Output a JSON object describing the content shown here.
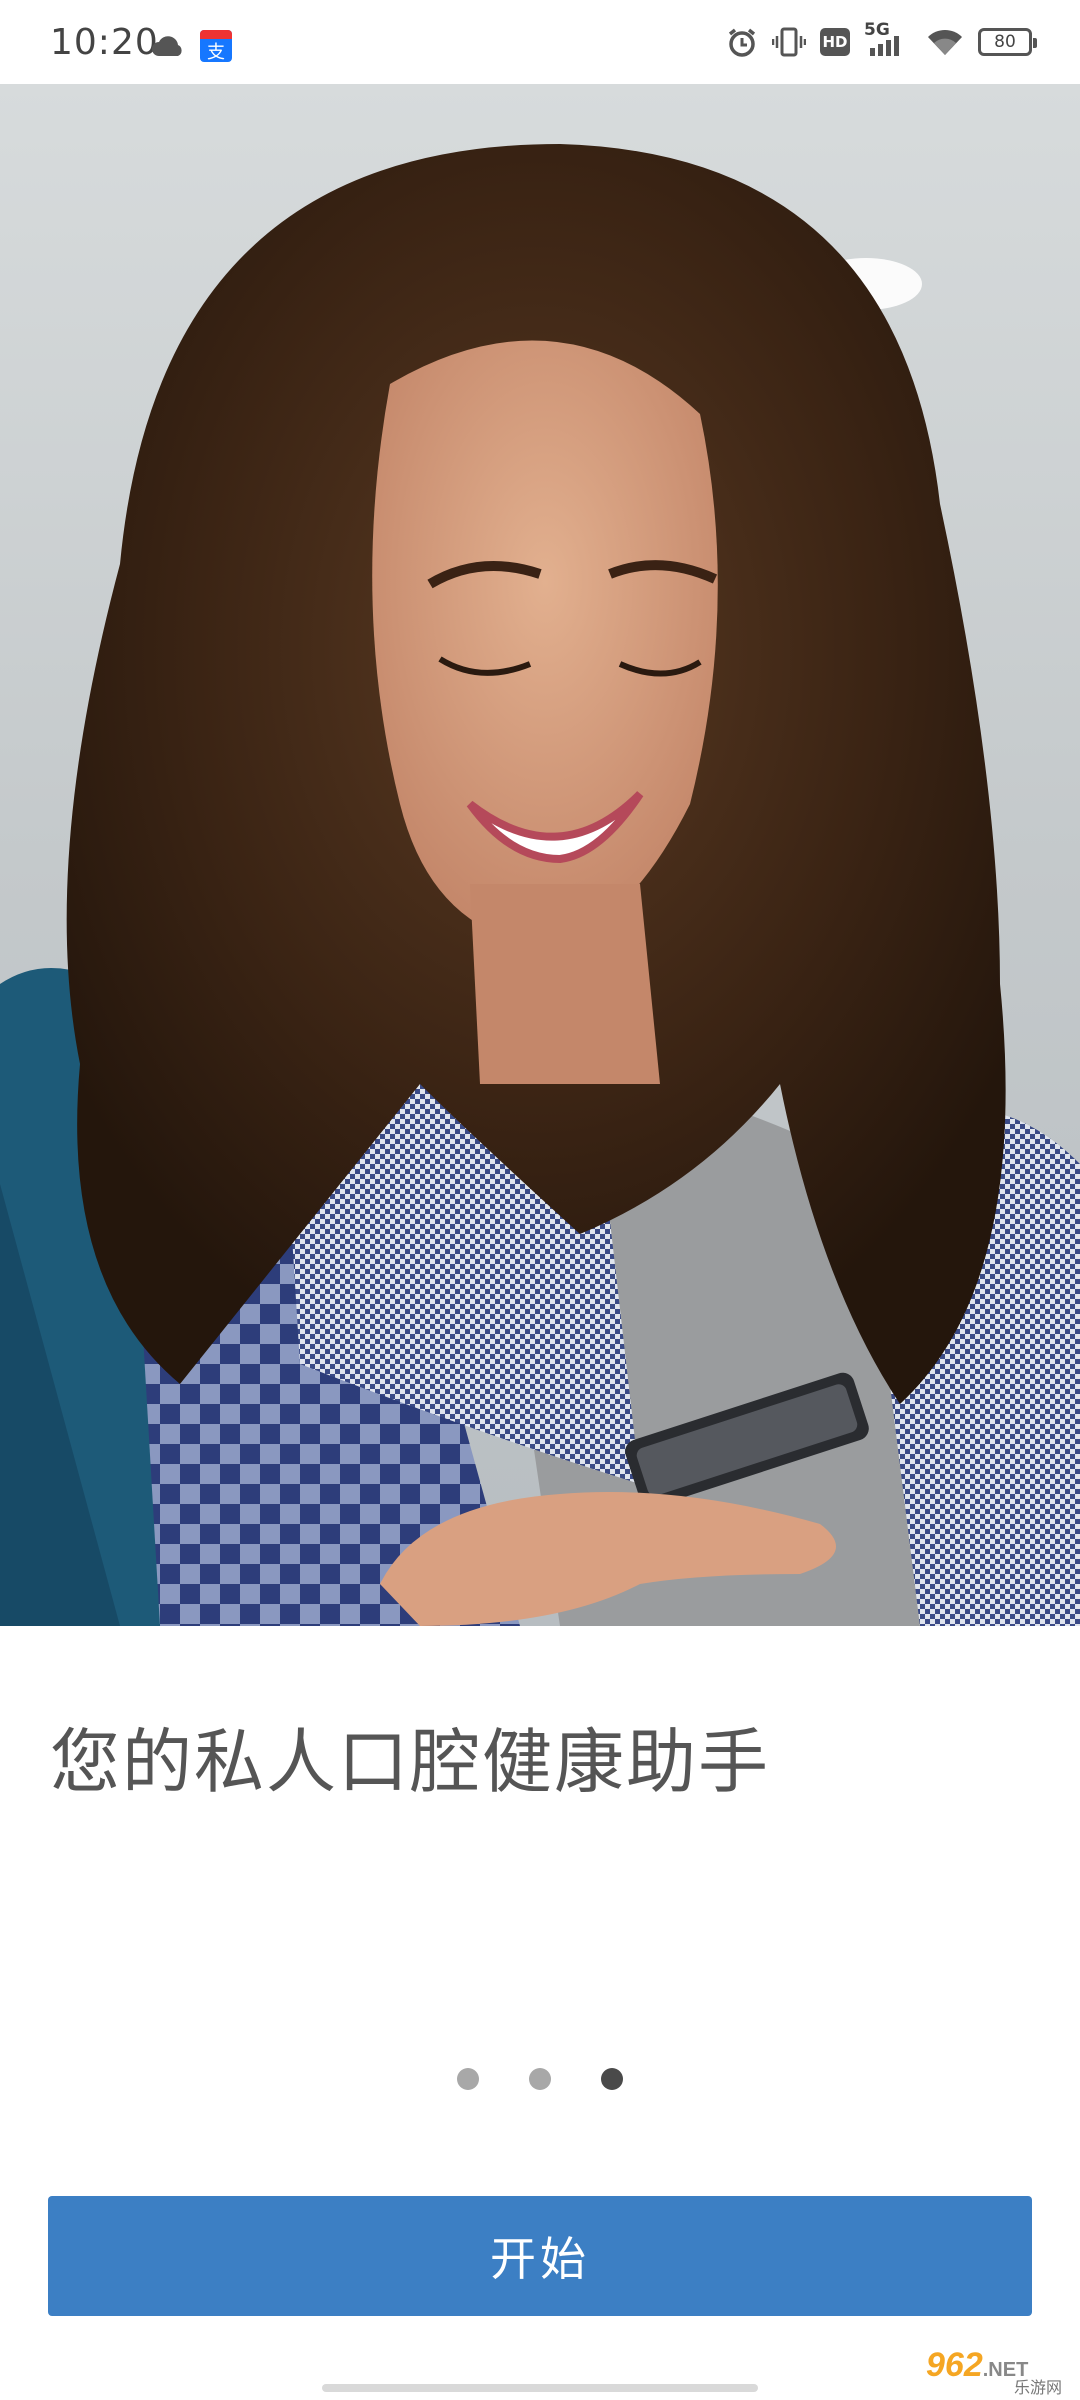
{
  "status_bar": {
    "time": "10:20",
    "network": "5G",
    "hd_label": "HD",
    "battery": "80",
    "left_icons": [
      "cloud-icon",
      "alipay-icon"
    ],
    "right_icons": [
      "alarm-icon",
      "vibrate-icon",
      "hd-icon",
      "signal-icon",
      "wifi-icon",
      "battery-icon"
    ]
  },
  "hero": {
    "image": "woman-smiling-at-phone-photo"
  },
  "onboarding": {
    "headline": "您的私人口腔健康助手",
    "page_count": 3,
    "active_page": 3,
    "start_label": "开始"
  },
  "watermark": {
    "main": "962",
    "suffix": ".NET",
    "sub": "乐游网"
  },
  "colors": {
    "button": "#3c7fc4",
    "dot_inactive": "#a8a8a8",
    "dot_active": "#4a4a4a",
    "headline": "#555555"
  }
}
